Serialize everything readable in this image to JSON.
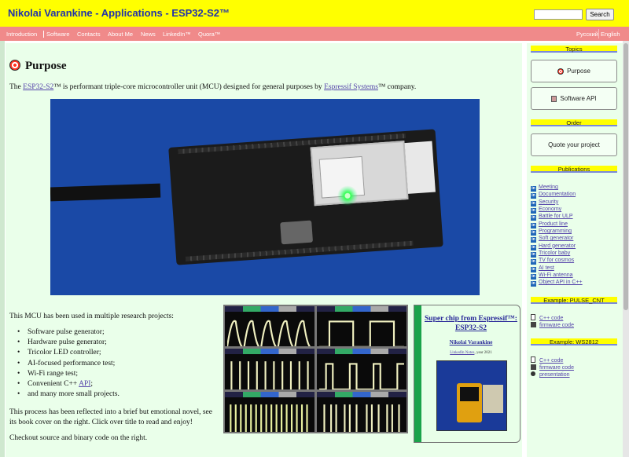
{
  "header": {
    "title": "Nikolai Varankine - Applications - ESP32-S2™",
    "search_placeholder": "",
    "search_button": "Search"
  },
  "nav": {
    "items": [
      "Introduction",
      "Software",
      "Contacts",
      "About Me",
      "News",
      "LinkedIn™",
      "Quora™"
    ],
    "active": "Software",
    "lang": [
      "Русский",
      "English"
    ]
  },
  "main": {
    "heading": "Purpose",
    "intro_pre": "The ",
    "intro_link": "ESP32-S2",
    "intro_mid": "™ is performant triple-core microcontroller unit (MCU) designed for general purposes by ",
    "intro_link2": "Espressif Systems",
    "intro_post": "™ company.",
    "research_text": "This MCU has been used in multiple research projects:",
    "bullets": [
      "Software pulse generator;",
      "Hardware pulse generator;",
      "Tricolor LED controller;",
      "AI-focused performance test;",
      "Wi-Fi range test;",
      "Convenient C++ ",
      "and many more small projects."
    ],
    "api_link": "API",
    "api_after": ";",
    "novel_text": "This process has been reflected into a brief but emotional novel, see its book cover on the right. Click over title to read and enjoy!",
    "checkout_text": "Checkout source and binary code on the right."
  },
  "book": {
    "title": "Super chip from Espressif™: ESP32-S2",
    "author": "Nikolai Varankine",
    "notes_link": "LinkedIn Notes",
    "notes_year": ", year 2021"
  },
  "sidebar": {
    "topics_head": "Topics",
    "topics": [
      "Purpose",
      "Software API"
    ],
    "order_head": "Order",
    "order_button": "Quote your project",
    "publications_head": "Publications",
    "publications": [
      "Meeting",
      "Documentation",
      "Security",
      "Economy",
      "Battle for ULP",
      "Product line",
      "Programming",
      "Soft generator",
      "Hard generator",
      "Tricolor baby",
      "TV for cosmos",
      "AI test",
      "Wi-Fi antenna",
      "Object API in C++"
    ],
    "example1_head": "Example: PULSE_CNT",
    "example1_links": [
      "C++ code",
      "firmware code"
    ],
    "example2_head": "Example: WS2812",
    "example2_links": [
      "C++ code",
      "firmware code",
      "presentation"
    ]
  },
  "colors": {
    "header_bg": "#ffff00",
    "nav_bg": "#f08a8a",
    "content_bg": "#eaffea",
    "link": "#5544aa"
  }
}
